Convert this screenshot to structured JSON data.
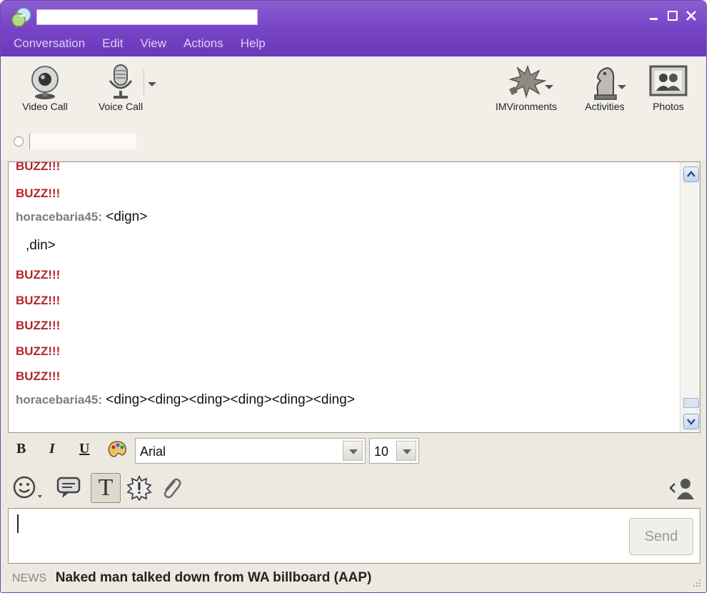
{
  "window": {
    "title": ""
  },
  "menu": [
    "Conversation",
    "Edit",
    "View",
    "Actions",
    "Help"
  ],
  "toolbar": {
    "video_call": "Video Call",
    "voice_call": "Voice Call",
    "imvironments": "IMVironments",
    "activities": "Activities",
    "photos": "Photos"
  },
  "status": {
    "text": ""
  },
  "messages": [
    {
      "type": "buzz",
      "text": "BUZZ!!!"
    },
    {
      "type": "buzz",
      "text": "BUZZ!!!"
    },
    {
      "type": "chat",
      "sender": "horacebaria45:",
      "text": "<dign>"
    },
    {
      "type": "continuation",
      "text": ",din>"
    },
    {
      "type": "buzz",
      "text": "BUZZ!!!"
    },
    {
      "type": "buzz",
      "text": "BUZZ!!!"
    },
    {
      "type": "buzz",
      "text": "BUZZ!!!"
    },
    {
      "type": "buzz",
      "text": "BUZZ!!!"
    },
    {
      "type": "buzz",
      "text": "BUZZ!!!"
    },
    {
      "type": "chat",
      "sender": "horacebaria45:",
      "text": "<ding><ding><ding><ding><ding><ding>"
    }
  ],
  "format": {
    "bold": "B",
    "italic": "I",
    "underline": "U",
    "font": "Arial",
    "size": "10"
  },
  "emoticons": {
    "text_button": "T"
  },
  "input": {
    "value": ""
  },
  "send_label": "Send",
  "news": {
    "label": "NEWS",
    "headline": "Naked man talked down from WA billboard (AAP)"
  },
  "colors": {
    "titlebar": "#7a46c8",
    "buzz": "#b3252a",
    "sender": "#7d7d7d"
  }
}
